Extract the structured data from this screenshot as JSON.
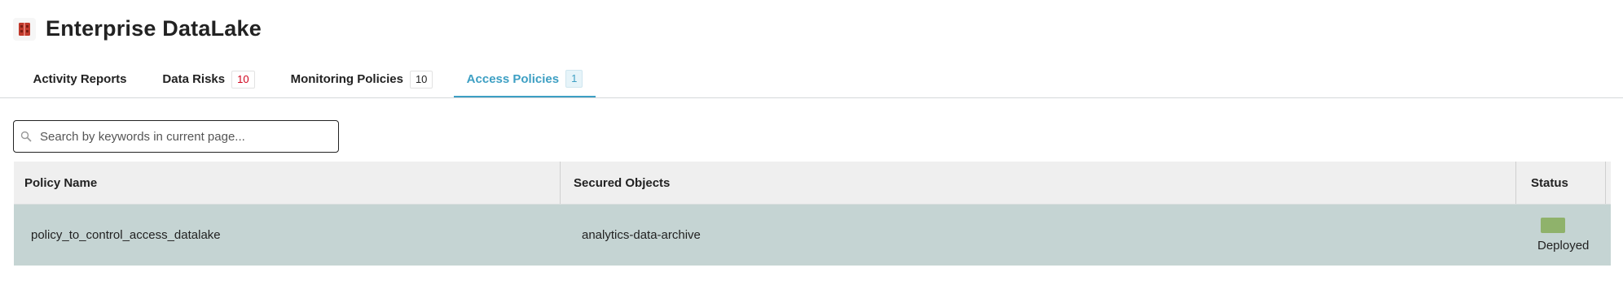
{
  "app": {
    "title": "Enterprise DataLake",
    "icon": "datalake-logo-icon",
    "icon_color": "#c0392b"
  },
  "tabs": [
    {
      "label": "Activity Reports",
      "count": ""
    },
    {
      "label": "Data Risks",
      "count": "10"
    },
    {
      "label": "Monitoring Policies",
      "count": "10"
    },
    {
      "label": "Access Policies",
      "count": "1",
      "active": true
    }
  ],
  "search": {
    "icon": "search-icon",
    "placeholder": "Search by keywords in current page..."
  },
  "table": {
    "columns": [
      "Policy Name",
      "Secured Objects",
      "Status"
    ],
    "rows": [
      {
        "policy_name": "policy_to_control_access_datalake",
        "secured_objects": "analytics-data-archive",
        "status": "Deployed",
        "status_color": "#8fb26b"
      }
    ],
    "selected_row_color": "#c5d4d3"
  },
  "colors": {
    "accent": "#3d9fc3",
    "risk_badge": "#d0021b"
  }
}
